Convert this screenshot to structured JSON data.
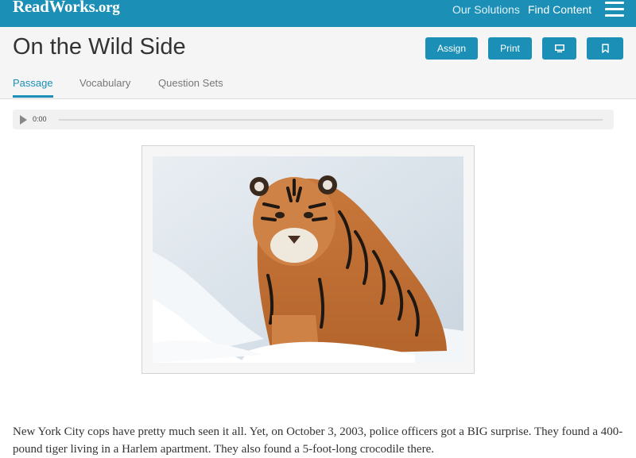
{
  "topbar": {
    "logo_main": "ReadWorks",
    "logo_suffix": ".org",
    "nav_solutions": "Our Solutions",
    "nav_find": "Find Content",
    "menu_icon": "hamburger-menu-icon"
  },
  "header": {
    "title": "On the Wild Side",
    "buttons": {
      "assign": "Assign",
      "print": "Print",
      "present_icon": "monitor-icon",
      "bookmark_icon": "bookmark-icon"
    },
    "tabs": [
      {
        "label": "Passage",
        "active": true
      },
      {
        "label": "Vocabulary",
        "active": false
      },
      {
        "label": "Question Sets",
        "active": false
      }
    ]
  },
  "audio": {
    "time": "0:00",
    "progress": 0
  },
  "passage": {
    "image_subject": "tiger standing in snow",
    "text": "New York City cops have pretty much seen it all. Yet, on October 3, 2003, police officers got a BIG surprise. They found a 400-pound tiger living in a Harlem apartment. They also found a 5-foot-long crocodile there."
  },
  "colors": {
    "brand": "#1b8fb5",
    "header_bg": "#f5f5f5"
  }
}
